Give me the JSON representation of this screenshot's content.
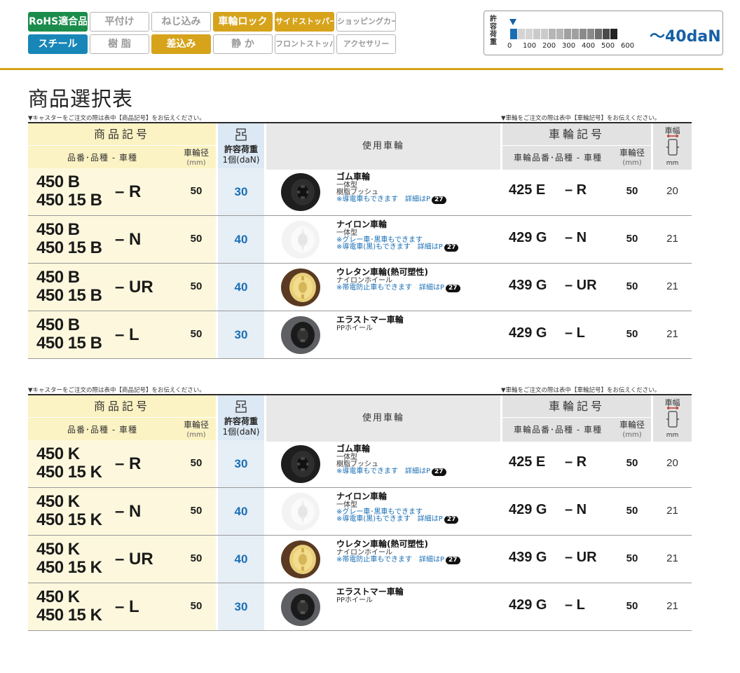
{
  "badges": {
    "row1": [
      "RoHS適合品",
      "平付け",
      "ねじ込み",
      "車輪ロック",
      "サイドストッパー",
      "ショッピングカート"
    ],
    "row2": [
      "スチール",
      "樹 脂",
      "差込み",
      "静 か",
      "フロントストッパー",
      "アクセサリー"
    ]
  },
  "load_indicator": {
    "label": "許容荷重",
    "ticks": [
      "0",
      "100",
      "200",
      "300",
      "400",
      "500",
      "600"
    ],
    "value": "〜40daN",
    "level": 40
  },
  "title": "商品選択表",
  "notes": {
    "left": "▼キャスターをご注文の際は表中【商品記号】をお伝えください。",
    "right": "▼車輪をご注文の際は表中【車輪記号】をお伝えください。"
  },
  "headers": {
    "product_code": "商品記号",
    "product_sub": "品番･品種 - 車種",
    "diameter": "車輪径",
    "unit_mm": "(mm)",
    "load": "許容荷重",
    "load_unit": "1個(daN)",
    "wheel_used": "使用車輪",
    "wheel_code": "車輪記号",
    "wheel_sub": "車輪品番･品種 - 車種",
    "width": "車幅",
    "width_unit": "mm"
  },
  "tables": [
    {
      "rows": [
        {
          "pn1": "450 B",
          "pn2": "450 15 B",
          "suffix": "– R",
          "dia": "50",
          "load": "30",
          "wheel": "rubber",
          "name": "ゴム車輪",
          "d1": "一体型",
          "d2": "樹脂ブッシュ",
          "d3": "※導電車もできます　詳細はP",
          "pg": "27",
          "wcode": "425 E",
          "wsfx": "– R",
          "wdia": "50",
          "width": "20"
        },
        {
          "pn1": "450 B",
          "pn2": "450 15 B",
          "suffix": "– N",
          "dia": "50",
          "load": "40",
          "wheel": "nylon",
          "name": "ナイロン車輪",
          "d1": "一体型",
          "d2": "※グレー車･黒車もできます",
          "d3": "※導電車(黒)もできます　詳細はP",
          "pg": "27",
          "wcode": "429 G",
          "wsfx": "– N",
          "wdia": "50",
          "width": "21"
        },
        {
          "pn1": "450 B",
          "pn2": "450 15 B",
          "suffix": "– UR",
          "dia": "50",
          "load": "40",
          "wheel": "urethane",
          "name": "ウレタン車輪(熱可塑性)",
          "d1": "ナイロンホイール",
          "d2": "※帯電防止車もできます　詳細はP",
          "d3": "",
          "pg": "27",
          "wcode": "439 G",
          "wsfx": "– UR",
          "wdia": "50",
          "width": "21"
        },
        {
          "pn1": "450 B",
          "pn2": "450 15 B",
          "suffix": "– L",
          "dia": "50",
          "load": "30",
          "wheel": "elastomer",
          "name": "エラストマー車輪",
          "d1": "PPホイール",
          "d2": "",
          "d3": "",
          "pg": "",
          "wcode": "429 G",
          "wsfx": "– L",
          "wdia": "50",
          "width": "21"
        }
      ]
    },
    {
      "rows": [
        {
          "pn1": "450 K",
          "pn2": "450 15 K",
          "suffix": "– R",
          "dia": "50",
          "load": "30",
          "wheel": "rubber",
          "name": "ゴム車輪",
          "d1": "一体型",
          "d2": "樹脂ブッシュ",
          "d3": "※導電車もできます　詳細はP",
          "pg": "27",
          "wcode": "425 E",
          "wsfx": "– R",
          "wdia": "50",
          "width": "20"
        },
        {
          "pn1": "450 K",
          "pn2": "450 15 K",
          "suffix": "– N",
          "dia": "50",
          "load": "40",
          "wheel": "nylon",
          "name": "ナイロン車輪",
          "d1": "一体型",
          "d2": "※グレー車･黒車もできます",
          "d3": "※導電車(黒)もできます　詳細はP",
          "pg": "27",
          "wcode": "429 G",
          "wsfx": "– N",
          "wdia": "50",
          "width": "21"
        },
        {
          "pn1": "450 K",
          "pn2": "450 15 K",
          "suffix": "– UR",
          "dia": "50",
          "load": "40",
          "wheel": "urethane",
          "name": "ウレタン車輪(熱可塑性)",
          "d1": "ナイロンホイール",
          "d2": "※帯電防止車もできます　詳細はP",
          "d3": "",
          "pg": "27",
          "wcode": "439 G",
          "wsfx": "– UR",
          "wdia": "50",
          "width": "21"
        },
        {
          "pn1": "450 K",
          "pn2": "450 15 K",
          "suffix": "– L",
          "dia": "50",
          "load": "30",
          "wheel": "elastomer",
          "name": "エラストマー車輪",
          "d1": "PPホイール",
          "d2": "",
          "d3": "",
          "pg": "",
          "wcode": "429 G",
          "wsfx": "– L",
          "wdia": "50",
          "width": "21"
        }
      ]
    }
  ],
  "colors": {
    "accent_gold": "#d6a31b",
    "rohs_green": "#1b8c4b",
    "steel_blue": "#1887b8",
    "load_blue": "#1a6fb4"
  }
}
